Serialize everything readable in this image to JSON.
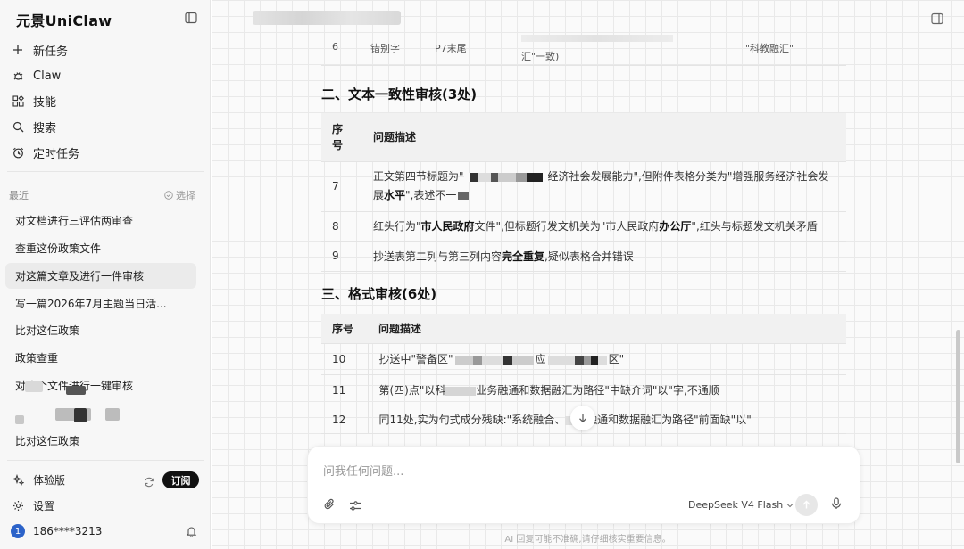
{
  "brand": "元景UniClaw",
  "nav": [
    {
      "label": "新任务",
      "icon": "plus-icon"
    },
    {
      "label": "Claw",
      "icon": "claw-icon"
    },
    {
      "label": "技能",
      "icon": "skills-icon"
    },
    {
      "label": "搜索",
      "icon": "search-icon"
    },
    {
      "label": "定时任务",
      "icon": "clock-icon"
    }
  ],
  "recent": {
    "label": "最近",
    "select_label": "选择",
    "items": [
      "对文档进行三评估两审查",
      "查重这份政策文件",
      "对这篇文章及进行一件审核",
      "写一篇2026年7月主题当日活...",
      "比对这仨政策",
      "政策查重",
      "对这个文件进行一键审核",
      "",
      "比对这仨政策"
    ]
  },
  "bottom": {
    "plan_label": "体验版",
    "subscribe_label": "订阅",
    "settings_label": "设置",
    "user_phone": "186****3213",
    "avatar_letter": "1"
  },
  "doc": {
    "top_row": {
      "no": "6",
      "type": "错别字",
      "loc": "P7末尾",
      "desc": "汇\"一致)",
      "suggest": "\"科教融汇\""
    },
    "section2_title": "二、文本一致性审核(3处)",
    "section2_header": {
      "no": "序号",
      "desc": "问题描述"
    },
    "section2_rows": [
      {
        "no": "7",
        "desc_a": "正文第四节标题为\"",
        "desc_b": "经济社会发展能力\",但附件表格分类为\"增强服务经济社会发展",
        "desc_bold": "水平",
        "desc_c": "\",表述不一"
      },
      {
        "no": "8",
        "p1": "红头行为\"",
        "b1": "市人民政府",
        "p2": "文件\",但标题行发文机关为\"市人民政府",
        "b2": "办公厅",
        "p3": "\",红头与标题发文机关矛盾"
      },
      {
        "no": "9",
        "p1": "抄送表第二列与第三列内容",
        "b1": "完全重复",
        "p2": ",疑似表格合并错误"
      }
    ],
    "section3_title": "三、格式审核(6处)",
    "section3_header": {
      "no": "序号",
      "desc": "问题描述"
    },
    "section3_rows": [
      {
        "no": "10",
        "p1": "抄送中\"警备区\"",
        "p2": "应",
        "p3": "区\""
      },
      {
        "no": "11",
        "p1": "第(四)点\"以科",
        "p2": "业务融通和数据融汇为路径\"中缺介词\"以\"字,不通顺"
      },
      {
        "no": "12",
        "p1": "同11处,实为句式成分残缺:\"系统融合、",
        "p2": "融通和数据融汇为路径\"前面缺\"以\""
      }
    ]
  },
  "composer": {
    "placeholder": "问我任何问题...",
    "model": "DeepSeek V4 Flash"
  },
  "disclaimer": "AI 回复可能不准确,请仔细核实重要信息。"
}
